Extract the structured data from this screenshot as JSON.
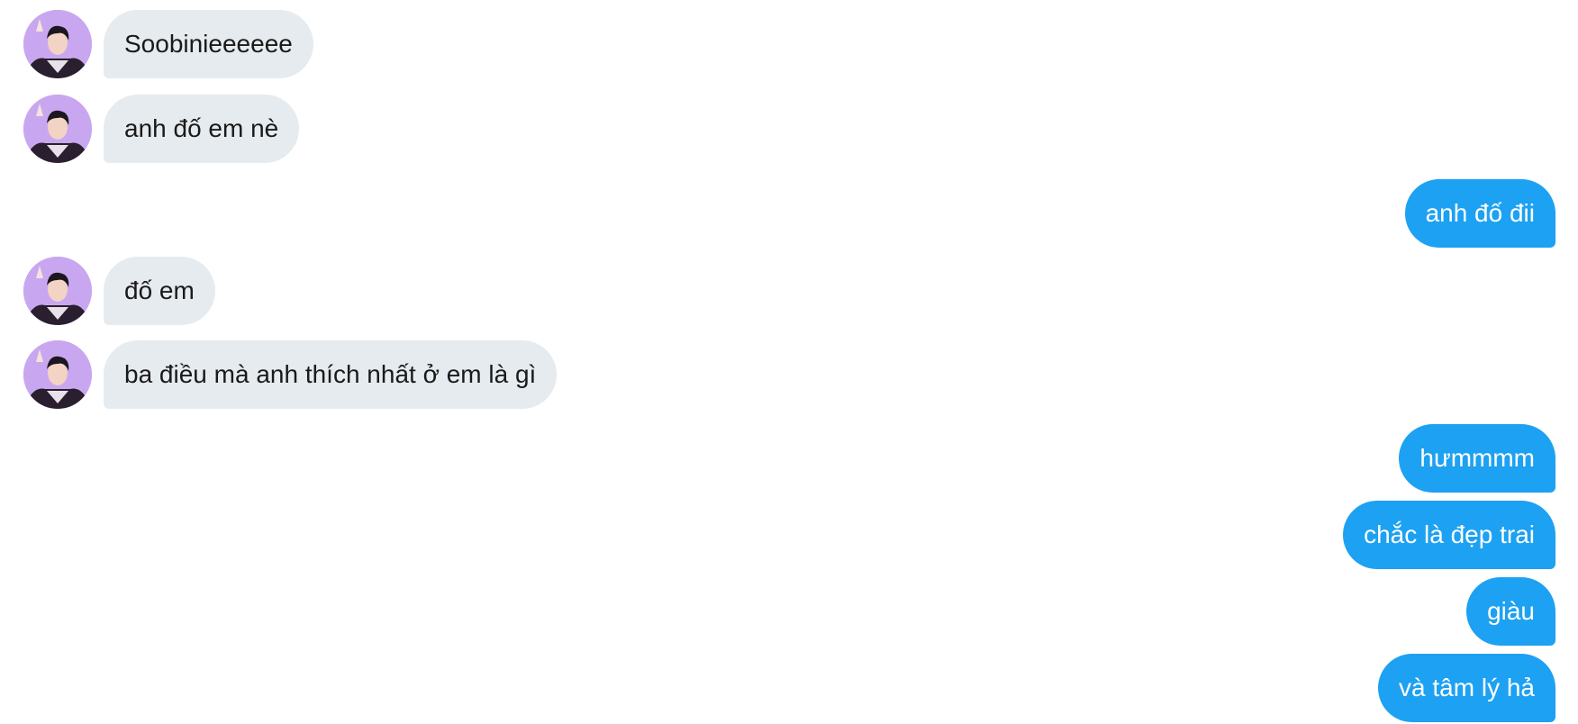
{
  "conversation": {
    "messages": [
      {
        "direction": "incoming",
        "text": "Soobinieeeeee"
      },
      {
        "direction": "incoming",
        "text": "anh đố em nè"
      },
      {
        "direction": "outgoing",
        "text": "anh đố đii"
      },
      {
        "direction": "incoming",
        "text": "đố em"
      },
      {
        "direction": "incoming",
        "text": "ba điều mà anh thích nhất ở em là gì"
      },
      {
        "direction": "outgoing",
        "text": "hưmmmm"
      },
      {
        "direction": "outgoing",
        "text": "chắc là đẹp trai"
      },
      {
        "direction": "outgoing",
        "text": "giàu"
      },
      {
        "direction": "outgoing",
        "text": "và tâm lý hả"
      }
    ]
  },
  "colors": {
    "incoming_bubble": "#e6ebef",
    "outgoing_bubble": "#1da1f2",
    "avatar_bg": "#c9a7f0"
  },
  "icons": {
    "avatar": "avatar-photo-icon"
  }
}
